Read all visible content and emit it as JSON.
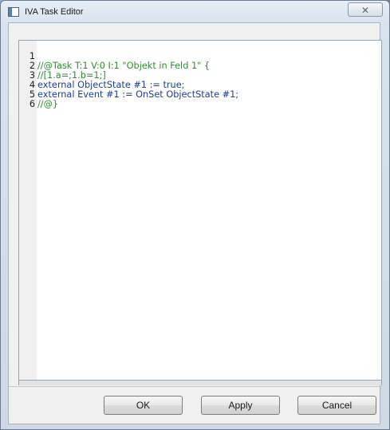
{
  "window": {
    "title": "IVA Task Editor",
    "close_label": "✕"
  },
  "editor": {
    "lines": [
      {
        "number": "1",
        "text": "//@Task T:1 V:0 I:1 \"Objekt in Feld 1\" {",
        "kind": "comment"
      },
      {
        "number": "2",
        "text": "//[1.a=;1.b=1;]",
        "kind": "comment"
      },
      {
        "number": "3",
        "text": "external ObjectState #1 := true;",
        "kind": "code"
      },
      {
        "number": "4",
        "text": "external Event #1 := OnSet ObjectState #1;",
        "kind": "code"
      },
      {
        "number": "5",
        "text": "//@}",
        "kind": "comment"
      },
      {
        "number": "6",
        "text": "",
        "kind": "code"
      }
    ]
  },
  "buttons": {
    "ok_label": "OK",
    "apply_label": "Apply",
    "cancel_label": "Cancel"
  },
  "colors": {
    "comment": "#2f8f2f",
    "code": "#1d3f8f"
  }
}
